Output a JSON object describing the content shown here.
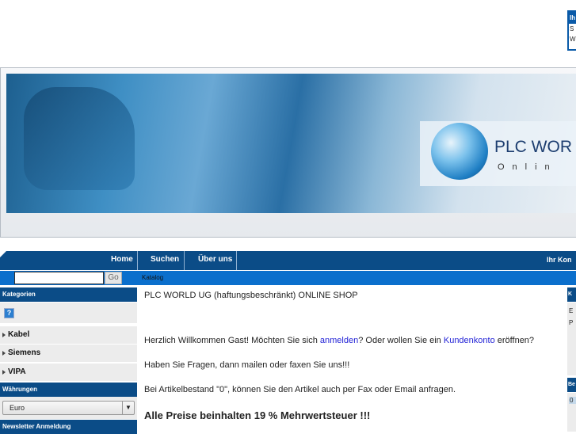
{
  "top_box": {
    "title": "Ih",
    "lines": [
      "S",
      "W"
    ]
  },
  "banner": {
    "logo_title": "PLC WOR",
    "logo_subtitle": "Onlin"
  },
  "nav": {
    "home": "Home",
    "search": "Suchen",
    "about": "Über uns",
    "account": "Ihr Kon"
  },
  "search": {
    "value": "",
    "button": "Go"
  },
  "breadcrumb": "Katalog",
  "sidebar": {
    "categories_title": "Kategorien",
    "help_icon": "?",
    "categories": [
      "Kabel",
      "Siemens",
      "VIPA"
    ],
    "currencies_title": "Währungen",
    "currency_selected": "Euro",
    "newsletter_title": "Newsletter Anmeldung"
  },
  "main": {
    "heading": "PLC WORLD UG (haftungsbeschränkt) ONLINE SHOP",
    "welcome_pre": "Herzlich Willkommen Gast! Möchten Sie sich ",
    "login_link": "anmelden",
    "welcome_mid": "? Oder wollen Sie ein ",
    "account_link": "Kundenkonto",
    "welcome_post": " eröffnen?",
    "questions": "Haben Sie Fragen, dann mailen oder faxen Sie uns!!!",
    "stock_note": "Bei Artikelbestand \"0\", können Sie den Artikel auch per Fax oder Email anfragen.",
    "vat_note": "Alle Preise beinhalten 19 % Mehrwertsteuer !!!"
  },
  "right": {
    "login_title": "K",
    "login_lines": [
      "E",
      "P"
    ],
    "cart_title": "Be",
    "cart_value": "0"
  }
}
